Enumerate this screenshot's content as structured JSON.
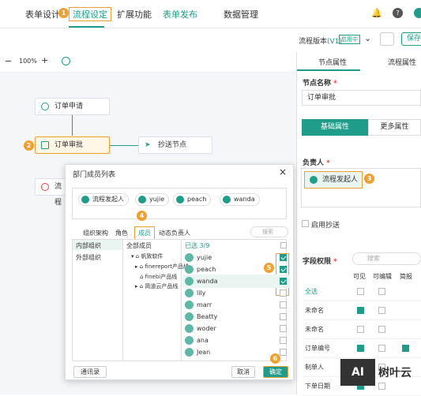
{
  "topbar": {
    "tabs": [
      "表单设计",
      "流程设定",
      "扩展功能",
      "表单发布",
      "数据管理"
    ],
    "markers": {
      "m1": "1",
      "m2": "2",
      "m3": "3",
      "m4": "4",
      "m5": "5",
      "m6": "6"
    }
  },
  "version": {
    "label": "流程版本",
    "version": "(V1)",
    "badge": "启用中",
    "save": "保存"
  },
  "zoom": {
    "minus": "−",
    "value": "100%",
    "plus": "+"
  },
  "flow": {
    "start": "订单申请",
    "approve": "订单审批",
    "cc": "抄送节点",
    "end": "流程"
  },
  "right": {
    "tab1": "节点属性",
    "tab2": "流程属性",
    "node_name_label": "节点名称",
    "node_name_value": "订单审批",
    "basic": "基础属性",
    "more": "更多属性",
    "owner_label": "负责人",
    "owner_chip": "流程发起人",
    "cc_label": "启用抄送",
    "field_label": "字段权限",
    "search_ph": "搜索",
    "cols": [
      "可见",
      "可编辑",
      "简报"
    ],
    "fields": [
      {
        "name": "全选",
        "v": false,
        "e": false,
        "green": true
      },
      {
        "name": "未命名",
        "v": true,
        "e": false,
        "green": false
      },
      {
        "name": "未命名",
        "v": false,
        "e": false,
        "green": false
      },
      {
        "name": "订单编号",
        "v": true,
        "e": false,
        "b": true,
        "green": false
      },
      {
        "name": "制单人",
        "v": true,
        "e": false,
        "green": false
      },
      {
        "name": "下单日期",
        "v": true,
        "e": false,
        "green": false
      }
    ]
  },
  "dialog": {
    "title": "部门成员列表",
    "chips": [
      "流程发起人",
      "yujie",
      "peach",
      "wanda"
    ],
    "tabs": [
      "组织架构",
      "角色",
      "成员",
      "动态负责人"
    ],
    "search": "搜索",
    "left": [
      "内部组织",
      "外部组织"
    ],
    "tree_title": "全部成员",
    "tree": [
      "帆致软件",
      "finereport产品线",
      "finebi产品线",
      "简道云产品线"
    ],
    "selected": "已选 3/9",
    "members": [
      "yujie",
      "peach",
      "wanda",
      "lily",
      "marr",
      "Beatty",
      "woder",
      "ana",
      "Jean"
    ],
    "checked": [
      true,
      true,
      true,
      false,
      false,
      false,
      false,
      false,
      false
    ],
    "contacts": "通讯录",
    "cancel": "取消",
    "ok": "确定"
  },
  "watermark": "树叶云"
}
